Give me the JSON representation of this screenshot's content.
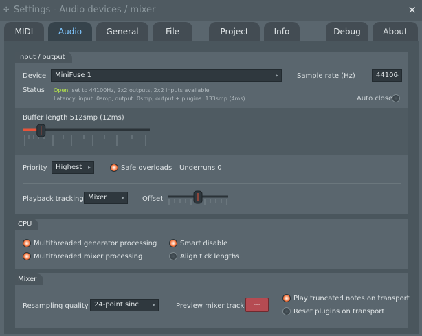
{
  "window": {
    "title": "Settings - Audio devices / mixer",
    "title_icon": "drag-icon",
    "close_glyph": "×"
  },
  "tabs": [
    "MIDI",
    "Audio",
    "General",
    "File",
    "Project",
    "Info",
    "Debug",
    "About"
  ],
  "active_tab": "Audio",
  "io": {
    "header": "Input / output",
    "device_label": "Device",
    "device_value": "MiniFuse 1",
    "sample_rate_label": "Sample rate (Hz)",
    "sample_rate_value": "44100",
    "status_label": "Status",
    "status_open": "Open",
    "status_text": ", set to 44100Hz, 2x2 outputs, 2x2 inputs available",
    "latency_text": "Latency: input: 0smp, output: 0smp, output + plugins: 133smp (4ms)",
    "auto_close_label": "Auto close",
    "buffer_label": "Buffer length 512smp (12ms)",
    "buffer_level": 0.14,
    "priority_label": "Priority",
    "priority_value": "Highest",
    "safe_overloads_label": "Safe overloads",
    "underruns_label": "Underruns 0",
    "playback_label": "Playback tracking",
    "playback_value": "Mixer",
    "offset_label": "Offset",
    "offset_level": 0.5
  },
  "cpu": {
    "header": "CPU",
    "multi_gen_label": "Multithreaded generator processing",
    "multi_mixer_label": "Multithreaded mixer processing",
    "smart_disable_label": "Smart disable",
    "align_tick_label": "Align tick lengths"
  },
  "mixer": {
    "header": "Mixer",
    "resampling_label": "Resampling quality",
    "resampling_value": "24-point sinc",
    "preview_label": "Preview mixer track",
    "preview_value": "---",
    "play_truncated_label": "Play truncated notes on transport",
    "reset_plugins_label": "Reset plugins on transport"
  },
  "colors": {
    "accent": "#7fc7ff",
    "radio_on": "#f27038",
    "status_open": "#b8e84a",
    "preview_button": "#b54b52"
  }
}
